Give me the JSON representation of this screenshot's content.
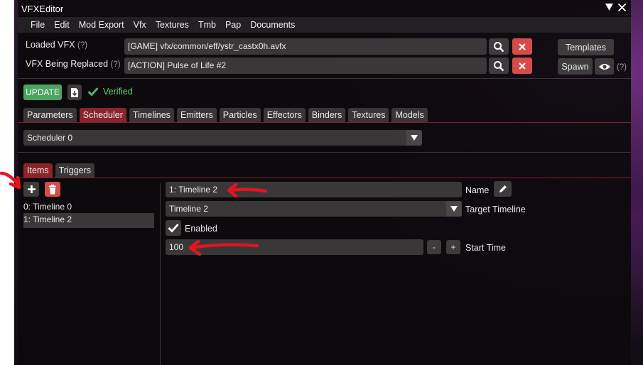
{
  "window": {
    "title": "VFXEditor",
    "title_icons": [
      "collapse-icon",
      "close-icon"
    ]
  },
  "menu": [
    "File",
    "Edit",
    "Mod Export",
    "Vfx",
    "Textures",
    "Tmb",
    "Pap",
    "Documents"
  ],
  "loaded_vfx": {
    "label": "Loaded VFX",
    "help": "(?)",
    "value": "[GAME] vfx/common/eff/ystr_castx0h.avfx"
  },
  "replaced_vfx": {
    "label": "VFX Being Replaced",
    "help": "(?)",
    "value": "[ACTION] Pulse of Life #2"
  },
  "templates_label": "Templates",
  "spawn_label": "Spawn",
  "spawn_help": "(?)",
  "update_label": "UPDATE",
  "verified_label": "Verified",
  "tabs": [
    "Parameters",
    "Scheduler",
    "Timelines",
    "Emitters",
    "Particles",
    "Effectors",
    "Binders",
    "Textures",
    "Models"
  ],
  "active_tab": "Scheduler",
  "scheduler_select": "Scheduler 0",
  "subtabs": [
    "Items",
    "Triggers"
  ],
  "active_subtab": "Items",
  "items": [
    "0: Timeline 0",
    "1: Timeline 2"
  ],
  "selected_item": "1: Timeline 2",
  "detail": {
    "name_value": "1: Timeline 2",
    "name_label": "Name",
    "target_value": "Timeline 2",
    "target_label": "Target Timeline",
    "enabled_label": "Enabled",
    "start_value": "100",
    "start_label": "Start Time",
    "minus": "-",
    "plus": "+"
  },
  "colors": {
    "accent_red": "#8a252b",
    "delete_red": "#d84b4b",
    "update_green": "#4aa560",
    "annotation_red": "#e4141c"
  }
}
